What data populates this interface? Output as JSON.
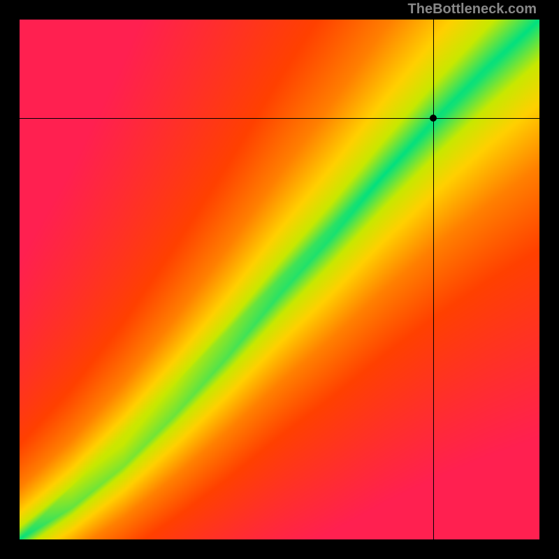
{
  "watermark": "TheBottleneck.com",
  "chart_data": {
    "type": "heatmap",
    "title": "",
    "xlabel": "",
    "ylabel": "",
    "xlim": [
      0,
      1
    ],
    "ylim": [
      0,
      1
    ],
    "x_axis_reversed": false,
    "y_axis_reversed": false,
    "marker": {
      "x": 0.796,
      "y": 0.81
    },
    "ideal_band": {
      "description": "Diagonal green band indicating balanced match; warm colors radiate outward.",
      "center_points": [
        {
          "x": 0.0,
          "y": 0.0
        },
        {
          "x": 0.1,
          "y": 0.06
        },
        {
          "x": 0.2,
          "y": 0.14
        },
        {
          "x": 0.3,
          "y": 0.24
        },
        {
          "x": 0.4,
          "y": 0.35
        },
        {
          "x": 0.5,
          "y": 0.47
        },
        {
          "x": 0.6,
          "y": 0.58
        },
        {
          "x": 0.7,
          "y": 0.7
        },
        {
          "x": 0.8,
          "y": 0.81
        },
        {
          "x": 0.9,
          "y": 0.91
        },
        {
          "x": 1.0,
          "y": 1.0
        }
      ],
      "band_half_width": 0.05
    },
    "color_scale": [
      {
        "distance": 0.0,
        "color": "#00e080"
      },
      {
        "distance": 0.1,
        "color": "#c8e800"
      },
      {
        "distance": 0.2,
        "color": "#ffd000"
      },
      {
        "distance": 0.35,
        "color": "#ff8000"
      },
      {
        "distance": 0.55,
        "color": "#ff4000"
      },
      {
        "distance": 1.0,
        "color": "#ff2050"
      }
    ]
  }
}
